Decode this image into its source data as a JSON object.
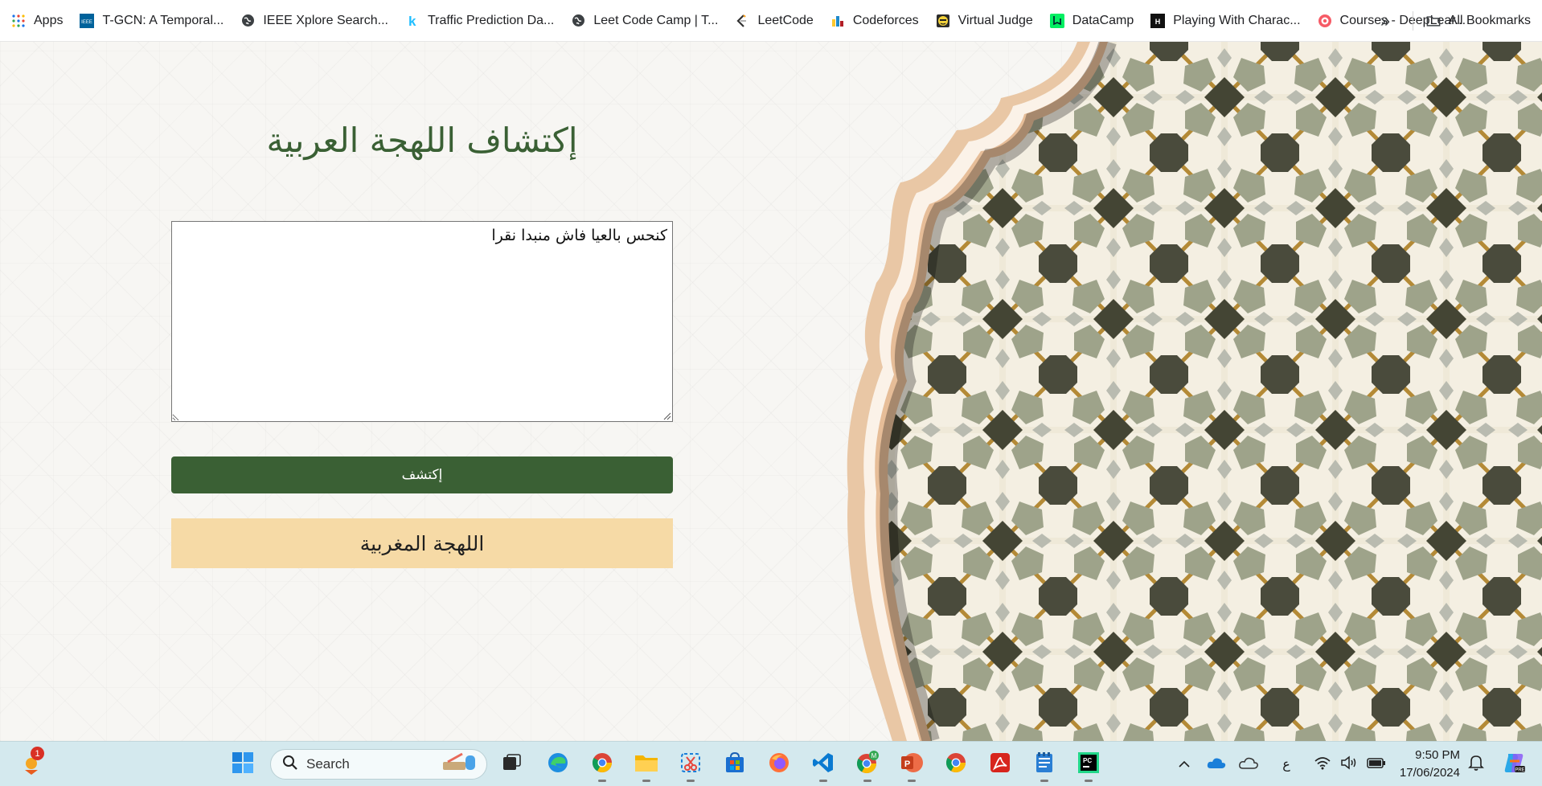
{
  "bookmarks": {
    "items": [
      {
        "label": "Apps",
        "icon": "apps-grid-icon"
      },
      {
        "label": "T-GCN: A Temporal...",
        "icon": "ieee-icon"
      },
      {
        "label": "IEEE Xplore Search...",
        "icon": "globe-icon"
      },
      {
        "label": "Traffic Prediction Da...",
        "icon": "kaggle-icon"
      },
      {
        "label": "Leet Code Camp | T...",
        "icon": "globe-icon"
      },
      {
        "label": "LeetCode",
        "icon": "leetcode-icon"
      },
      {
        "label": "Codeforces",
        "icon": "codeforces-icon"
      },
      {
        "label": "Virtual Judge",
        "icon": "virtual-judge-icon"
      },
      {
        "label": "DataCamp",
        "icon": "datacamp-icon"
      },
      {
        "label": "Playing With Charac...",
        "icon": "hashnode-icon"
      },
      {
        "label": "Courses - DeepLear...",
        "icon": "deeplearning-icon"
      }
    ],
    "overflow_label": "»",
    "all_bookmarks_label": "All Bookmarks"
  },
  "page": {
    "title": "إكتشاف اللهجة العربية",
    "input_value": "كنحس بالعيا فاش منبدا نقرا",
    "detect_button_label": "إكتشف",
    "result_text": "اللهجة المغربية"
  },
  "taskbar": {
    "search_placeholder": "Search",
    "notification_badge": "1",
    "time": "9:50 PM",
    "date": "17/06/2024",
    "language_indicator": "ع",
    "pinned_apps": [
      "windows-start-icon",
      "task-view-icon",
      "edge-icon",
      "chrome-icon",
      "file-explorer-icon",
      "snipping-tool-icon",
      "microsoft-store-icon",
      "firefox-icon",
      "vscode-icon",
      "chrome-profile-icon",
      "powerpoint-icon",
      "chrome-icon",
      "acrobat-icon",
      "notepad-icon",
      "pycharm-icon"
    ]
  },
  "colors": {
    "title_green": "#3a6034",
    "button_green": "#3a6034",
    "result_bg": "#f6daa6",
    "taskbar_bg": "#d4e9ee"
  }
}
